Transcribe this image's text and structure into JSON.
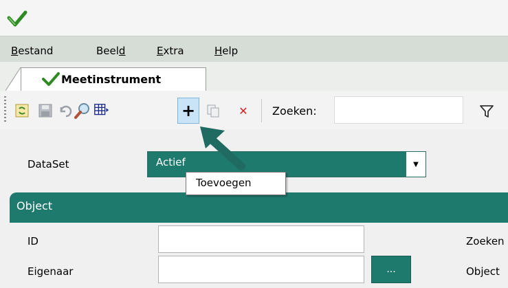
{
  "menu": {
    "items": [
      {
        "pre": "",
        "u": "B",
        "post": "estand"
      },
      {
        "pre": "Beel",
        "u": "d",
        "post": ""
      },
      {
        "pre": "",
        "u": "E",
        "post": "xtra"
      },
      {
        "pre": "",
        "u": "H",
        "post": "elp"
      }
    ]
  },
  "tab": {
    "label": "Meetinstrument"
  },
  "toolbar": {
    "add_symbol": "+",
    "delete_symbol": "✕",
    "search_label": "Zoeken:",
    "search_value": ""
  },
  "form": {
    "dataset_label": "DataSet",
    "dataset_value": "Actief",
    "tooltip": "Toevoegen",
    "section_title": "Object",
    "id_label": "ID",
    "owner_label": "Eigenaar",
    "browse_button": "...",
    "right_search_label": "Zoeken",
    "right_object_label": "Object"
  },
  "colors": {
    "accent": "#1f7a6e",
    "logo": "#2e8b22"
  }
}
